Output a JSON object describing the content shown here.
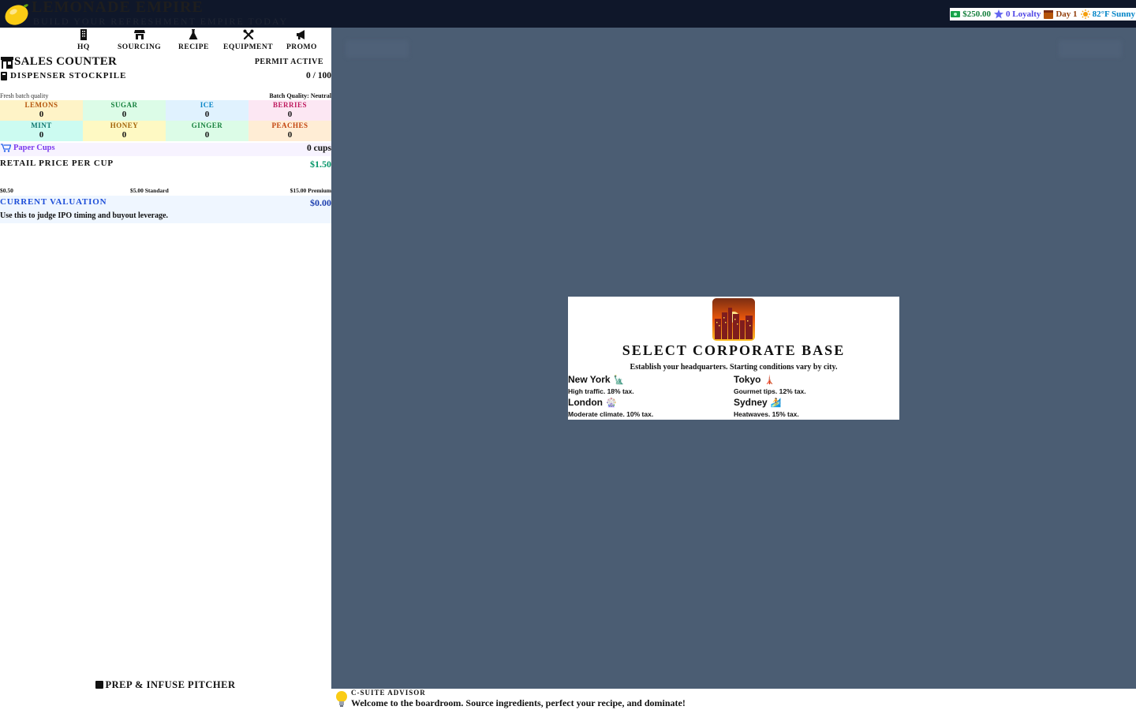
{
  "app": {
    "title": "LEMONADE EMPIRE",
    "subtitle": "BUILD YOUR REFRESHMENT EMPIRE TODAY"
  },
  "stats": {
    "money": "$250.00",
    "loyalty": "0 Loyalty",
    "day": "Day 1",
    "weather": "82°F Sunny"
  },
  "nav": {
    "items": [
      {
        "label": "HQ",
        "icon": "building-icon"
      },
      {
        "label": "SOURCING",
        "icon": "store-icon"
      },
      {
        "label": "RECIPE",
        "icon": "flask-icon"
      },
      {
        "label": "EQUIPMENT",
        "icon": "tools-icon"
      },
      {
        "label": "PROMO",
        "icon": "megaphone-icon"
      }
    ]
  },
  "counter": {
    "title": "SALES COUNTER",
    "permit": "PERMIT ACTIVE",
    "stockpile_label": "DISPENSER STOCKPILE",
    "stockpile_value": "0 / 100",
    "fresh_label": "Fresh batch quality",
    "batch_quality": "Batch Quality: Neutral",
    "ingredients": [
      {
        "name": "LEMONS",
        "qty": "0",
        "bg": "#fef3c7",
        "color": "#b45309"
      },
      {
        "name": "SUGAR",
        "qty": "0",
        "bg": "#dcfce7",
        "color": "#15803d"
      },
      {
        "name": "ICE",
        "qty": "0",
        "bg": "#e0f2fe",
        "color": "#0284c7"
      },
      {
        "name": "BERRIES",
        "qty": "0",
        "bg": "#fce7f3",
        "color": "#be185d"
      },
      {
        "name": "MINT",
        "qty": "0",
        "bg": "#ccfbf1",
        "color": "#0f766e"
      },
      {
        "name": "HONEY",
        "qty": "0",
        "bg": "#fef9c3",
        "color": "#a16207"
      },
      {
        "name": "GINGER",
        "qty": "0",
        "bg": "#dcfce7",
        "color": "#15803d"
      },
      {
        "name": "PEACHES",
        "qty": "0",
        "bg": "#ffedd5",
        "color": "#c2410c"
      }
    ],
    "cups_label": "Paper Cups",
    "cups_value": "0 cups",
    "price_label": "RETAIL PRICE PER CUP",
    "price_value": "$1.50",
    "price_min": "$0.50",
    "price_mid": "$5.00 Standard",
    "price_max": "$15.00 Premium",
    "valuation_label": "CURRENT VALUATION",
    "valuation_value": "$0.00",
    "valuation_hint": "Use this to judge IPO timing and buyout leverage.",
    "prep_button": "PREP & INFUSE PITCHER"
  },
  "modal": {
    "title": "SELECT CORPORATE BASE",
    "subtitle": "Establish your headquarters. Starting conditions vary by city.",
    "cities": [
      {
        "name": "New York",
        "emoji": "🗽",
        "desc": "High traffic. 18% tax."
      },
      {
        "name": "Tokyo",
        "emoji": "🗼",
        "desc": "Gourmet tips. 12% tax."
      },
      {
        "name": "London",
        "emoji": "🎡",
        "desc": "Moderate climate. 10% tax."
      },
      {
        "name": "Sydney",
        "emoji": "🏄",
        "desc": "Heatwaves. 15% tax."
      }
    ]
  },
  "advisor": {
    "label": "C-SUITE ADVISOR",
    "message": "Welcome to the boardroom. Source ingredients, perfect your recipe, and dominate!"
  },
  "colors": {
    "topbar": "#0f172a",
    "main_bg": "#4b5d73",
    "money": "#15803d",
    "loyalty": "#4f46e5",
    "price": "#059669",
    "valuation": "#1d4ed8"
  }
}
